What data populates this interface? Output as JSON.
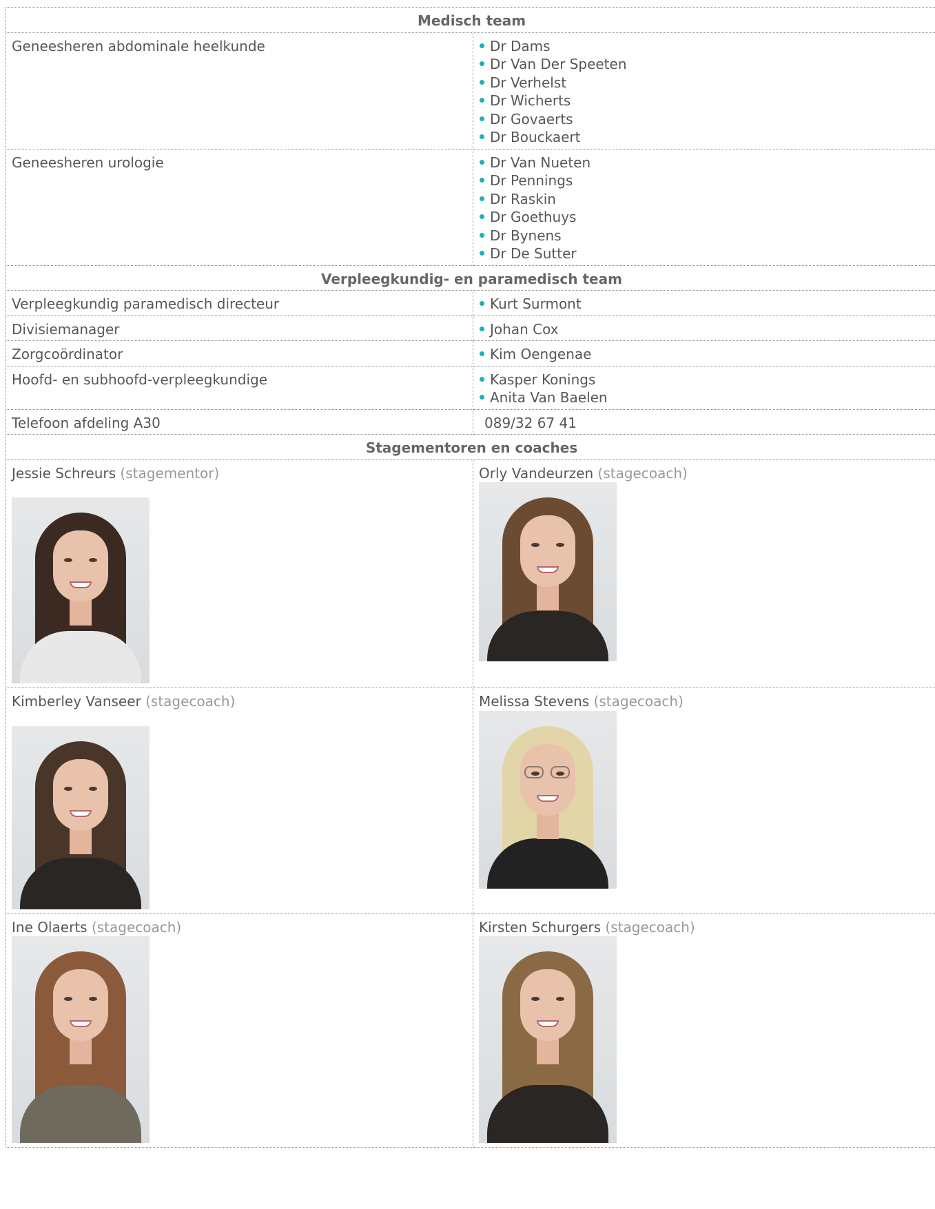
{
  "colors": {
    "bullet": "#1ab2b5",
    "text": "#575757",
    "role_text": "#999999",
    "border": "#8a8a8a"
  },
  "medical": {
    "title": "Medisch team",
    "abdominal": {
      "label": "Geneesheren abdominale heelkunde",
      "names": [
        "Dr Dams",
        "Dr Van Der Speeten",
        "Dr Verhelst",
        "Dr Wicherts",
        "Dr Govaerts",
        "Dr Bouckaert"
      ]
    },
    "urology": {
      "label": "Geneesheren urologie",
      "names": [
        "Dr Van Nueten",
        "Dr Pennings",
        "Dr Raskin",
        "Dr Goethuys",
        "Dr Bynens",
        "Dr De Sutter"
      ]
    }
  },
  "nursing": {
    "title": "Verpleegkundig- en paramedisch team",
    "director": {
      "label": "Verpleegkundig paramedisch directeur",
      "names": [
        "Kurt Surmont"
      ]
    },
    "division": {
      "label": "Divisiemanager",
      "names": [
        "Johan Cox"
      ]
    },
    "care": {
      "label": "Zorgcoördinator",
      "names": [
        "Kim Oengenae"
      ]
    },
    "head": {
      "label": "Hoofd- en subhoofd-verpleegkundige",
      "names": [
        "Kasper Konings",
        "Anita Van Baelen"
      ]
    },
    "phone": {
      "label": "Telefoon afdeling A30",
      "value": "089/32 67 41"
    }
  },
  "coaches": {
    "title": "Stagementoren en coaches",
    "people": [
      {
        "name": "Jessie Schreurs",
        "role": "(stagementor)",
        "hair": "#3b2a22",
        "top": "#e8e8e8"
      },
      {
        "name": "Orly Vandeurzen",
        "role": "(stagecoach)",
        "hair": "#6b4c33",
        "top": "#2a2624"
      },
      {
        "name": "Kimberley Vanseer",
        "role": "(stagecoach)",
        "hair": "#4a3628",
        "top": "#2a2624"
      },
      {
        "name": "Melissa Stevens",
        "role": "(stagecoach)",
        "hair": "#e2d6a8",
        "top": "#222222"
      },
      {
        "name": "Ine Olaerts",
        "role": "(stagecoach)",
        "hair": "#8a5a3a",
        "top": "#6e6a5e"
      },
      {
        "name": "Kirsten Schurgers",
        "role": "(stagecoach)",
        "hair": "#8a6a45",
        "top": "#2a2624"
      }
    ]
  }
}
